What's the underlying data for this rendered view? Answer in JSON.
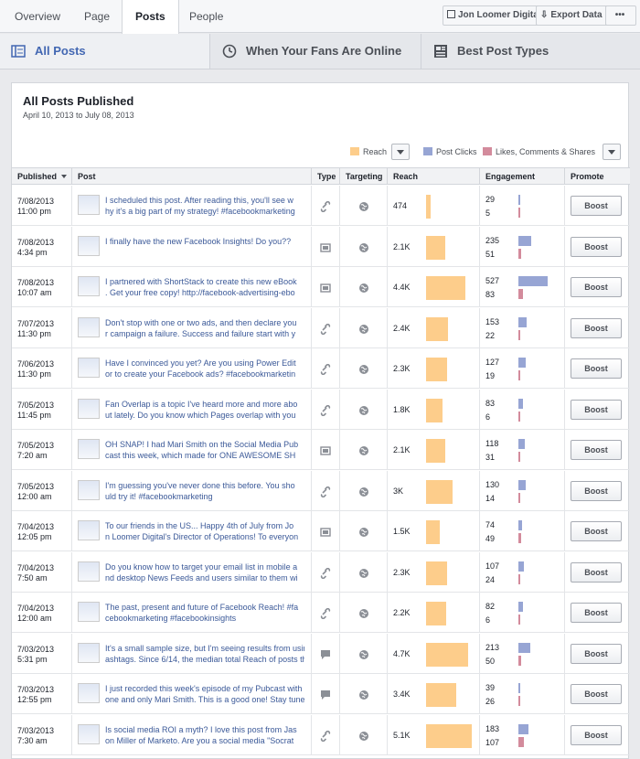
{
  "top_tabs": [
    "Overview",
    "Page",
    "Posts",
    "People"
  ],
  "page_button": "Jon Loomer Digital",
  "export_button": "Export Data",
  "more_label": "•••",
  "sub_tabs": [
    "All Posts",
    "When Your Fans Are Online",
    "Best Post Types"
  ],
  "panel": {
    "title": "All Posts Published",
    "subtitle": "April 10, 2013 to July 08, 2013"
  },
  "legend": {
    "reach": "Reach",
    "clicks": "Post Clicks",
    "likes": "Likes, Comments & Shares"
  },
  "colors": {
    "reach": "#fdcd8b",
    "clicks": "#97a5d4",
    "likes": "#d38b9c",
    "accent": "#4267b2"
  },
  "columns": [
    "Published",
    "Post",
    "Type",
    "Targeting",
    "Reach",
    "Engagement",
    "Promote"
  ],
  "reach_max": 5100,
  "click_max": 527,
  "posts": [
    {
      "date": "7/08/2013",
      "time": "11:00 pm",
      "line1": "I scheduled this post. After reading this, you'll see w",
      "line2": "hy it's a big part of my strategy! #facebookmarketing",
      "type": "link-icon",
      "reach": "474",
      "reach_value": 474,
      "clicks": "29",
      "likes": "5",
      "boost": "Boost"
    },
    {
      "date": "7/08/2013",
      "time": "4:34 pm",
      "line1": "I finally have the new Facebook Insights! Do you??",
      "line2": "",
      "type": "photo-icon",
      "reach": "2.1K",
      "reach_value": 2100,
      "clicks": "235",
      "likes": "51",
      "boost": "Boost"
    },
    {
      "date": "7/08/2013",
      "time": "10:07 am",
      "line1": "I partnered with ShortStack to create this new eBook",
      "line2": ". Get your free copy! http://facebook-advertising-ebo",
      "type": "photo-icon",
      "reach": "4.4K",
      "reach_value": 4400,
      "clicks": "527",
      "likes": "83",
      "boost": "Boost"
    },
    {
      "date": "7/07/2013",
      "time": "11:30 pm",
      "line1": "Don't stop with one or two ads, and then declare you",
      "line2": "r campaign a failure. Success and failure start with y",
      "type": "link-icon",
      "reach": "2.4K",
      "reach_value": 2400,
      "clicks": "153",
      "likes": "22",
      "boost": "Boost"
    },
    {
      "date": "7/06/2013",
      "time": "11:30 pm",
      "line1": "Have I convinced you yet? Are you using Power Edit",
      "line2": "or to create your Facebook ads? #facebookmarketin",
      "type": "link-icon",
      "reach": "2.3K",
      "reach_value": 2300,
      "clicks": "127",
      "likes": "19",
      "boost": "Boost"
    },
    {
      "date": "7/05/2013",
      "time": "11:45 pm",
      "line1": "Fan Overlap is a topic I've heard more and more abo",
      "line2": "ut lately. Do you know which Pages overlap with you",
      "type": "link-icon",
      "reach": "1.8K",
      "reach_value": 1800,
      "clicks": "83",
      "likes": "6",
      "boost": "Boost"
    },
    {
      "date": "7/05/2013",
      "time": "7:20 am",
      "line1": "OH SNAP! I had Mari Smith on the Social Media Pub",
      "line2": "cast this week, which made for ONE AWESOME SH",
      "type": "photo-icon",
      "reach": "2.1K",
      "reach_value": 2100,
      "clicks": "118",
      "likes": "31",
      "boost": "Boost"
    },
    {
      "date": "7/05/2013",
      "time": "12:00 am",
      "line1": "I'm guessing you've never done this before. You sho",
      "line2": "uld try it! #facebookmarketing",
      "type": "link-icon",
      "reach": "3K",
      "reach_value": 3000,
      "clicks": "130",
      "likes": "14",
      "boost": "Boost"
    },
    {
      "date": "7/04/2013",
      "time": "12:05 pm",
      "line1": "To our friends in the US... Happy 4th of July from Jo",
      "line2": "n Loomer Digital's Director of Operations! To everyon",
      "type": "photo-icon",
      "reach": "1.5K",
      "reach_value": 1500,
      "clicks": "74",
      "likes": "49",
      "boost": "Boost"
    },
    {
      "date": "7/04/2013",
      "time": "7:50 am",
      "line1": "Do you know how to target your email list in mobile a",
      "line2": "nd desktop News Feeds and users similar to them wi",
      "type": "link-icon",
      "reach": "2.3K",
      "reach_value": 2300,
      "clicks": "107",
      "likes": "24",
      "boost": "Boost"
    },
    {
      "date": "7/04/2013",
      "time": "12:00 am",
      "line1": "The past, present and future of Facebook Reach! #fa",
      "line2": "cebookmarketing #facebookinsights",
      "type": "link-icon",
      "reach": "2.2K",
      "reach_value": 2200,
      "clicks": "82",
      "likes": "6",
      "boost": "Boost"
    },
    {
      "date": "7/03/2013",
      "time": "5:31 pm",
      "line1": "It's a small sample size, but I'm seeing results from using h",
      "line2": "ashtags. Since 6/14, the median total Reach of posts that in",
      "type": "status-icon",
      "reach": "4.7K",
      "reach_value": 4700,
      "clicks": "213",
      "likes": "50",
      "boost": "Boost"
    },
    {
      "date": "7/03/2013",
      "time": "12:55 pm",
      "line1": "I just recorded this week's episode of my Pubcast with the",
      "line2": "one and only Mari Smith. This is a good one! Stay tuned!",
      "type": "status-icon",
      "reach": "3.4K",
      "reach_value": 3400,
      "clicks": "39",
      "likes": "26",
      "boost": "Boost"
    },
    {
      "date": "7/03/2013",
      "time": "7:30 am",
      "line1": "Is social media ROI a myth? I love this post from Jas",
      "line2": "on Miller of Marketo. Are you a social media \"Socrat",
      "type": "link-icon",
      "reach": "5.1K",
      "reach_value": 5100,
      "clicks": "183",
      "likes": "107",
      "boost": "Boost"
    }
  ]
}
